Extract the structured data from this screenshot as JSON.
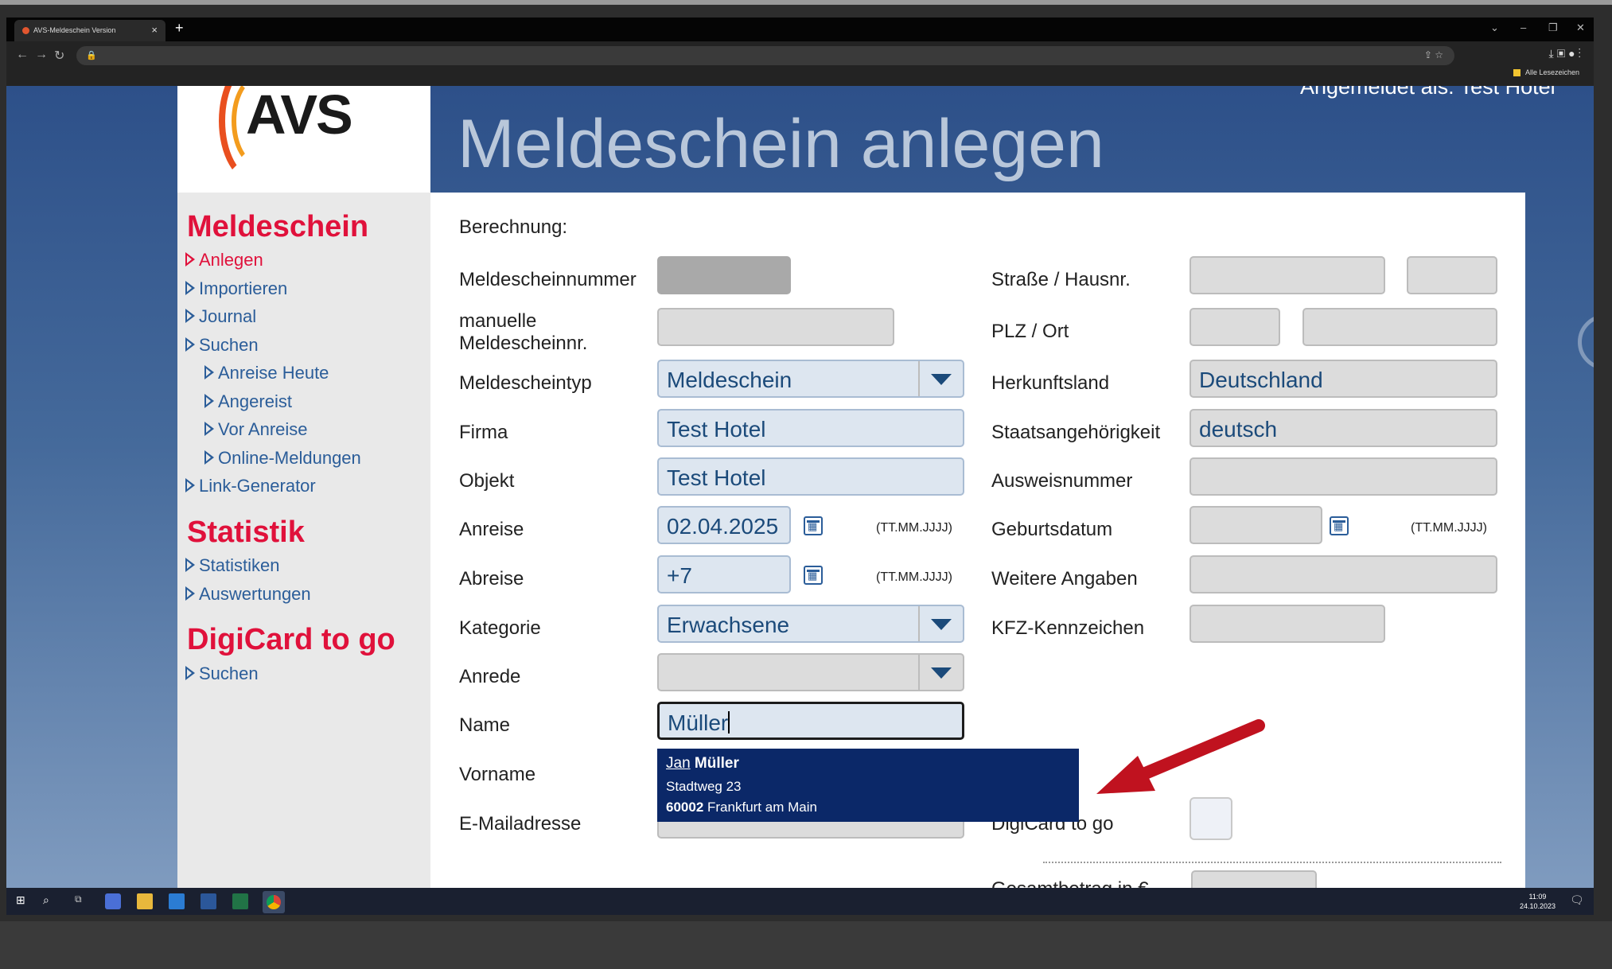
{
  "browser": {
    "tab_title": "AVS-Meldeschein Version",
    "bookmarks_label": "Alle Lesezeichen"
  },
  "header": {
    "logo_text": "AVS",
    "login_info": "Angemeldet als: Test Hotel",
    "page_title": "Meldeschein anlegen"
  },
  "sidebar": {
    "sections": [
      {
        "heading": "Meldeschein",
        "items": [
          "Anlegen",
          "Importieren",
          "Journal",
          "Suchen",
          "Anreise Heute",
          "Angereist",
          "Vor Anreise",
          "Online-Meldungen",
          "Link-Generator"
        ]
      },
      {
        "heading": "Statistik",
        "items": [
          "Statistiken",
          "Auswertungen"
        ]
      },
      {
        "heading": "DigiCard to go",
        "items": [
          "Suchen"
        ]
      }
    ]
  },
  "form": {
    "section_label": "Berechnung:",
    "labels": {
      "meldescheinnummer": "Meldescheinnummer",
      "manuelle_nr_1": "manuelle",
      "manuelle_nr_2": "Meldescheinnr.",
      "meldescheintyp": "Meldescheintyp",
      "firma": "Firma",
      "objekt": "Objekt",
      "anreise": "Anreise",
      "abreise": "Abreise",
      "kategorie": "Kategorie",
      "anrede": "Anrede",
      "name": "Name",
      "vorname": "Vorname",
      "email": "E-Mailadresse",
      "strasse": "Straße / Hausnr.",
      "plz_ort": "PLZ / Ort",
      "herkunftsland": "Herkunftsland",
      "staatsangehoerigkeit": "Staatsangehörigkeit",
      "ausweisnummer": "Ausweisnummer",
      "geburtsdatum": "Geburtsdatum",
      "weitere_angaben": "Weitere Angaben",
      "kfz": "KFZ-Kennzeichen",
      "digicard": "DigiCard to go",
      "gesamtbetrag": "Gesamtbetrag in €"
    },
    "values": {
      "meldescheintyp": "Meldeschein",
      "firma": "Test Hotel",
      "objekt": "Test Hotel",
      "anreise": "02.04.2025",
      "abreise": "+7",
      "kategorie": "Erwachsene",
      "name": "Müller",
      "herkunftsland": "Deutschland",
      "staatsangehoerigkeit": "deutsch"
    },
    "date_hint": "(TT.MM.JJJJ)"
  },
  "autocomplete": {
    "first_name": "Jan",
    "last_name": "Müller",
    "street": "Stadtweg 23",
    "zip": "60002",
    "city": "Frankfurt am Main"
  },
  "taskbar": {
    "time": "11:09",
    "date": "24.10.2023"
  },
  "colors": {
    "sidebar_heading": "#e0113b",
    "sidebar_link": "#2b5d99",
    "dropdown_bg": "#0b2868",
    "arrow": "#c0121f"
  }
}
